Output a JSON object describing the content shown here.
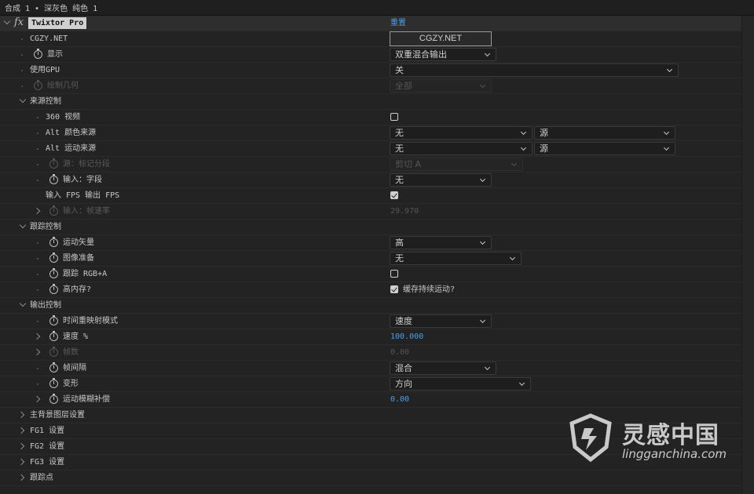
{
  "window": {
    "title": "合成 1 • 深灰色 纯色 1"
  },
  "effect": {
    "name": "Twixtor Pro",
    "reset_label": "重置",
    "cgzy_label": "CGZY.NET",
    "cgzy_button": "CGZY.NET"
  },
  "params": {
    "display_label": "显示",
    "display_value": "双重混合输出",
    "gpu_label": "使用GPU",
    "gpu_value": "关",
    "draw_geo_label": "绘制几何",
    "draw_geo_value": "全部",
    "source_group": "来源控制",
    "video360_label": "360 视频",
    "video360_checked": false,
    "alt_color_label": "Alt 颜色来源",
    "alt_color_value": "无",
    "alt_color_src": "源",
    "alt_motion_label": "Alt 运动来源",
    "alt_motion_value": "无",
    "alt_motion_src": "源",
    "source_mark_label": "源：标记分段",
    "source_mark_value": "剪切 A",
    "input_field_label": "输入：字段",
    "input_field_value": "无",
    "fps_label": "输入 FPS 输出 FPS",
    "fps_checked": true,
    "input_rate_label": "输入：帧速率",
    "input_rate_value": "29.970",
    "track_group": "跟踪控制",
    "motion_vec_label": "运动矢量",
    "motion_vec_value": "高",
    "image_prep_label": "图像准备",
    "image_prep_value": "无",
    "track_rgba_label": "跟踪 RGB+A",
    "track_rgba_checked": false,
    "high_mem_label": "高内存?",
    "high_mem_checked": true,
    "cache_label": "缓存持续运动?",
    "output_group": "输出控制",
    "remap_label": "时间重映射模式",
    "remap_value": "速度",
    "speed_label": "速度 %",
    "speed_value": "100.000",
    "frames_label": "帧数",
    "frames_value": "0.00",
    "interp_label": "帧间隔",
    "interp_value": "混合",
    "warp_label": "变形",
    "warp_value": "方向",
    "mblur_label": "运动模糊补偿",
    "mblur_value": "0.00",
    "bg_group": "主背景图层设置",
    "fg1_group": "FG1 设置",
    "fg2_group": "FG2 设置",
    "fg3_group": "FG3 设置",
    "track_points_group": "跟踪点"
  },
  "watermark": {
    "main": "灵感中国",
    "sub": "lingganchina.com"
  },
  "colors": {
    "accent": "#4a9fe8",
    "bg": "#232323"
  }
}
